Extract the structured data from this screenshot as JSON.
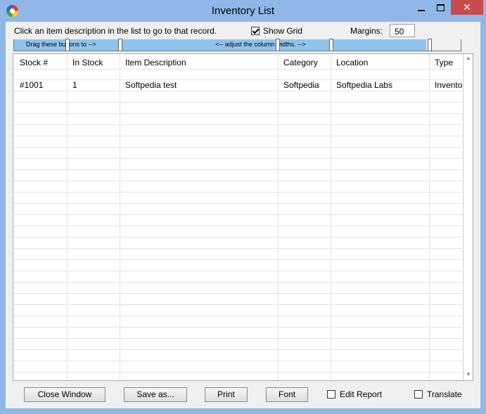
{
  "window": {
    "title": "Inventory List",
    "close_glyph": "✕"
  },
  "toolbar": {
    "instruction": "Click an item description in the list to go to that record.",
    "show_grid_label": "Show Grid",
    "show_grid_checked": true,
    "margins_label": "Margins:",
    "margins_value": "50"
  },
  "ruler": {
    "left_text": "Drag these buttons to -->",
    "right_text": "<-- adjust the column widths. -->"
  },
  "table": {
    "columns": [
      "Stock #",
      "In Stock",
      "Item Description",
      "Category",
      "Location",
      "Type"
    ],
    "rows": [
      [
        "#1001",
        "1",
        "Softpedia test",
        "Softpedia",
        "Softpedia Labs",
        "Inventory"
      ]
    ]
  },
  "buttons": {
    "close_window": "Close Window",
    "save_as": "Save as...",
    "print": "Print",
    "font": "Font",
    "edit_report": "Edit Report",
    "translate": "Translate"
  },
  "colors": {
    "frame": "#8fb8e8",
    "ruler_band": "#8fc3ef",
    "close_button": "#c74d4d"
  }
}
